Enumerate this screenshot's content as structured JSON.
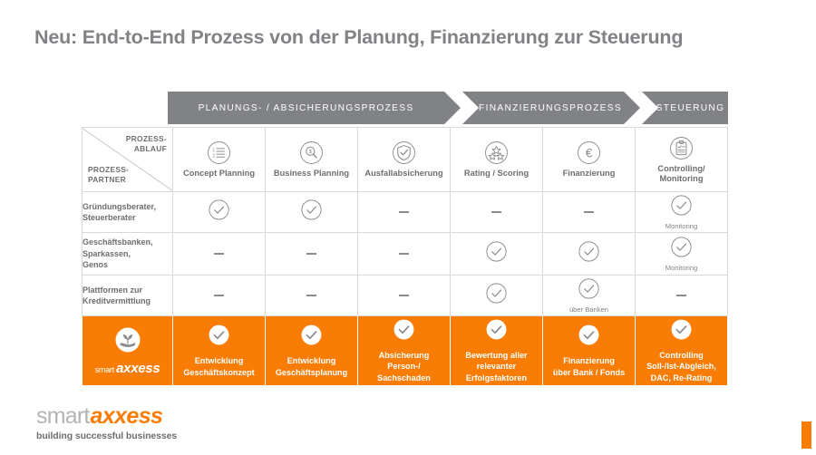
{
  "title": "Neu: End-to-End Prozess von der Planung, Finanzierung zur Steuerung",
  "colors": {
    "orange": "#f97d05",
    "gray": "#808285",
    "text": "#6d6e71",
    "border": "#d9d9d9"
  },
  "banner": {
    "segments": [
      {
        "label": "PLANUNGS- / ABSICHERUNGSPROZESS"
      },
      {
        "label": "FINANZIERUNGSPROZESS"
      },
      {
        "label": "STEUERUNG"
      }
    ]
  },
  "matrix": {
    "corner": {
      "top_label": "PROZESS-\nABLAUF",
      "top_line1": "PROZESS-",
      "top_line2": "ABLAUF",
      "bottom_line1": "PROZESS-",
      "bottom_line2": "PARTNER"
    },
    "columns": [
      {
        "label": "Concept Planning",
        "icon": "numbered-list-icon"
      },
      {
        "label": "Business Planning",
        "icon": "magnifier-dollar-icon"
      },
      {
        "label": "Ausfallabsicherung",
        "icon": "shield-check-icon"
      },
      {
        "label": "Rating / Scoring",
        "icon": "stars-icon"
      },
      {
        "label": "Finanzierung",
        "icon": "euro-icon"
      },
      {
        "label": "Controlling/\nMonitoring",
        "icon": "clipboard-check-icon",
        "label_line1": "Controlling/",
        "label_line2": "Monitoring"
      }
    ],
    "rows": [
      {
        "label_lines": [
          "Gründungsberater,",
          "Steuerberater"
        ],
        "cells": [
          {
            "type": "check"
          },
          {
            "type": "check"
          },
          {
            "type": "dash"
          },
          {
            "type": "dash"
          },
          {
            "type": "dash"
          },
          {
            "type": "check",
            "note": "Monitoring"
          }
        ]
      },
      {
        "label_lines": [
          "Geschäftsbanken,",
          "Sparkassen,",
          "Genos"
        ],
        "cells": [
          {
            "type": "dash"
          },
          {
            "type": "dash"
          },
          {
            "type": "dash"
          },
          {
            "type": "check"
          },
          {
            "type": "check"
          },
          {
            "type": "check",
            "note": "Monitoring"
          }
        ]
      },
      {
        "label_lines": [
          "Plattformen zur",
          "Kreditvermittlung"
        ],
        "cells": [
          {
            "type": "dash"
          },
          {
            "type": "dash"
          },
          {
            "type": "dash"
          },
          {
            "type": "check"
          },
          {
            "type": "check",
            "note": "über Banken"
          },
          {
            "type": "dash"
          }
        ]
      }
    ],
    "highlight_row": {
      "brand": {
        "icon": "hand-sprout-icon",
        "word1": "smart",
        "word2": "axxess"
      },
      "cells": [
        {
          "icon": "check-icon",
          "lines": [
            "Entwicklung",
            "Geschäftskonzept"
          ]
        },
        {
          "icon": "check-icon",
          "lines": [
            "Entwicklung",
            "Geschäftsplanung"
          ]
        },
        {
          "icon": "check-icon",
          "lines": [
            "Absicherung",
            "Person-/",
            "Sachschaden"
          ]
        },
        {
          "icon": "check-icon",
          "lines": [
            "Bewertung aller",
            "relevanter",
            "Erfolgsfaktoren"
          ]
        },
        {
          "icon": "check-icon",
          "lines": [
            "Finanzierung",
            "über  Bank / Fonds"
          ]
        },
        {
          "icon": "check-icon",
          "lines": [
            "Controlling",
            "Soll-/Ist-Abgleich,",
            "DAC, Re-Rating"
          ]
        }
      ]
    }
  },
  "footer": {
    "logo_word1": "smart",
    "logo_word2": "axxess",
    "tagline": "building successful businesses"
  }
}
